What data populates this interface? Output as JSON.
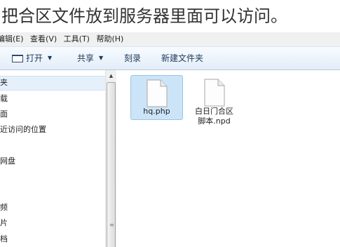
{
  "caption": "把合区文件放到服务器里面可以访问。",
  "menu": [
    "编辑(E)",
    "查看(V)",
    "工具(T)",
    "帮助(H)"
  ],
  "toolbar": {
    "open": "打开",
    "share": "共享",
    "burn": "刻录",
    "new_folder": "新建文件夹"
  },
  "nav": [
    {
      "label": "夹",
      "selected": true
    },
    {
      "label": "载",
      "selected": false
    },
    {
      "label": "面",
      "selected": false
    },
    {
      "label": "近访问的位置",
      "selected": false
    },
    {
      "label": "网盘",
      "selected": false
    },
    {
      "label": "频",
      "selected": false
    },
    {
      "label": "片",
      "selected": false
    },
    {
      "label": "档",
      "selected": false
    }
  ],
  "files": [
    {
      "line1": "hq.php",
      "line2": "",
      "selected": true
    },
    {
      "line1": "白日门合区",
      "line2": "脚本.npd",
      "selected": false
    }
  ],
  "icons": {
    "open": "open-icon",
    "file": "document-icon"
  }
}
